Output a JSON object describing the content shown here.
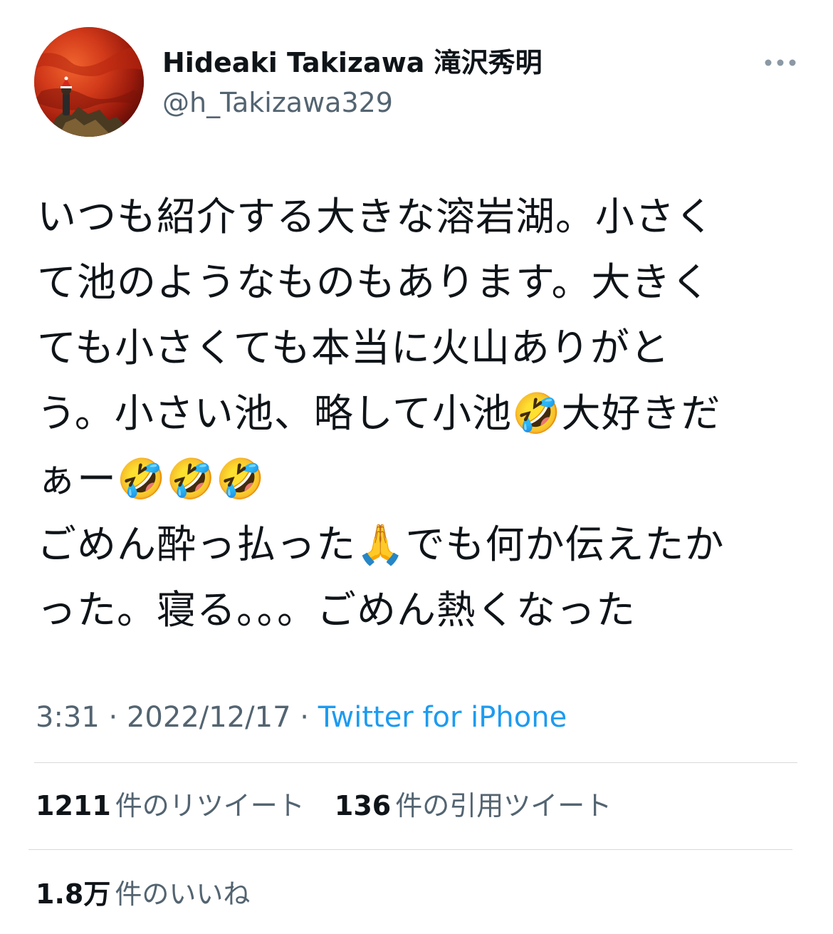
{
  "tweet": {
    "author": {
      "display_name": "Hideaki Takizawa 滝沢秀明",
      "handle": "@h_Takizawa329",
      "avatar_icon": "avatar-photo"
    },
    "more_icon": "more-horizontal-icon",
    "text_lines": [
      "いつも紹介する大きな溶岩湖。小さく",
      "て池のようなものもあります。大きく",
      "ても小さくても本当に火山ありがと",
      "う。小さい池、略して小池🤣大好きだ",
      "ぁー🤣🤣🤣",
      "ごめん酔っ払った🙏でも何か伝えたか",
      "った。寝る。。。ごめん熱くなった"
    ],
    "time": "3:31",
    "date": "2022/12/17",
    "separator": "·",
    "source": "Twitter for iPhone",
    "stats": {
      "retweets_count": "1211",
      "retweets_label": "件のリツイート",
      "quotes_count": "136",
      "quotes_label": "件の引用ツイート",
      "likes_count": "1.8万",
      "likes_label": "件のいいね"
    }
  },
  "colors": {
    "text": "#0f1419",
    "secondary": "#536471",
    "link": "#1d9bf0",
    "divider": "#d6d9dc"
  }
}
